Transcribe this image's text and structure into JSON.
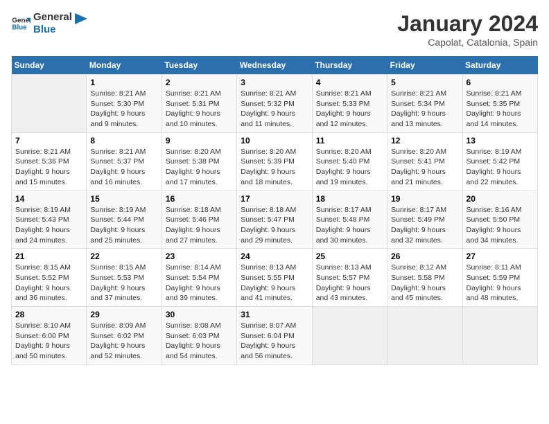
{
  "header": {
    "logo_line1": "General",
    "logo_line2": "Blue",
    "title": "January 2024",
    "subtitle": "Capolat, Catalonia, Spain"
  },
  "weekdays": [
    "Sunday",
    "Monday",
    "Tuesday",
    "Wednesday",
    "Thursday",
    "Friday",
    "Saturday"
  ],
  "weeks": [
    [
      {
        "day": "",
        "info": ""
      },
      {
        "day": "1",
        "info": "Sunrise: 8:21 AM\nSunset: 5:30 PM\nDaylight: 9 hours\nand 9 minutes."
      },
      {
        "day": "2",
        "info": "Sunrise: 8:21 AM\nSunset: 5:31 PM\nDaylight: 9 hours\nand 10 minutes."
      },
      {
        "day": "3",
        "info": "Sunrise: 8:21 AM\nSunset: 5:32 PM\nDaylight: 9 hours\nand 11 minutes."
      },
      {
        "day": "4",
        "info": "Sunrise: 8:21 AM\nSunset: 5:33 PM\nDaylight: 9 hours\nand 12 minutes."
      },
      {
        "day": "5",
        "info": "Sunrise: 8:21 AM\nSunset: 5:34 PM\nDaylight: 9 hours\nand 13 minutes."
      },
      {
        "day": "6",
        "info": "Sunrise: 8:21 AM\nSunset: 5:35 PM\nDaylight: 9 hours\nand 14 minutes."
      }
    ],
    [
      {
        "day": "7",
        "info": "Sunrise: 8:21 AM\nSunset: 5:36 PM\nDaylight: 9 hours\nand 15 minutes."
      },
      {
        "day": "8",
        "info": "Sunrise: 8:21 AM\nSunset: 5:37 PM\nDaylight: 9 hours\nand 16 minutes."
      },
      {
        "day": "9",
        "info": "Sunrise: 8:20 AM\nSunset: 5:38 PM\nDaylight: 9 hours\nand 17 minutes."
      },
      {
        "day": "10",
        "info": "Sunrise: 8:20 AM\nSunset: 5:39 PM\nDaylight: 9 hours\nand 18 minutes."
      },
      {
        "day": "11",
        "info": "Sunrise: 8:20 AM\nSunset: 5:40 PM\nDaylight: 9 hours\nand 19 minutes."
      },
      {
        "day": "12",
        "info": "Sunrise: 8:20 AM\nSunset: 5:41 PM\nDaylight: 9 hours\nand 21 minutes."
      },
      {
        "day": "13",
        "info": "Sunrise: 8:19 AM\nSunset: 5:42 PM\nDaylight: 9 hours\nand 22 minutes."
      }
    ],
    [
      {
        "day": "14",
        "info": "Sunrise: 8:19 AM\nSunset: 5:43 PM\nDaylight: 9 hours\nand 24 minutes."
      },
      {
        "day": "15",
        "info": "Sunrise: 8:19 AM\nSunset: 5:44 PM\nDaylight: 9 hours\nand 25 minutes."
      },
      {
        "day": "16",
        "info": "Sunrise: 8:18 AM\nSunset: 5:46 PM\nDaylight: 9 hours\nand 27 minutes."
      },
      {
        "day": "17",
        "info": "Sunrise: 8:18 AM\nSunset: 5:47 PM\nDaylight: 9 hours\nand 29 minutes."
      },
      {
        "day": "18",
        "info": "Sunrise: 8:17 AM\nSunset: 5:48 PM\nDaylight: 9 hours\nand 30 minutes."
      },
      {
        "day": "19",
        "info": "Sunrise: 8:17 AM\nSunset: 5:49 PM\nDaylight: 9 hours\nand 32 minutes."
      },
      {
        "day": "20",
        "info": "Sunrise: 8:16 AM\nSunset: 5:50 PM\nDaylight: 9 hours\nand 34 minutes."
      }
    ],
    [
      {
        "day": "21",
        "info": "Sunrise: 8:15 AM\nSunset: 5:52 PM\nDaylight: 9 hours\nand 36 minutes."
      },
      {
        "day": "22",
        "info": "Sunrise: 8:15 AM\nSunset: 5:53 PM\nDaylight: 9 hours\nand 37 minutes."
      },
      {
        "day": "23",
        "info": "Sunrise: 8:14 AM\nSunset: 5:54 PM\nDaylight: 9 hours\nand 39 minutes."
      },
      {
        "day": "24",
        "info": "Sunrise: 8:13 AM\nSunset: 5:55 PM\nDaylight: 9 hours\nand 41 minutes."
      },
      {
        "day": "25",
        "info": "Sunrise: 8:13 AM\nSunset: 5:57 PM\nDaylight: 9 hours\nand 43 minutes."
      },
      {
        "day": "26",
        "info": "Sunrise: 8:12 AM\nSunset: 5:58 PM\nDaylight: 9 hours\nand 45 minutes."
      },
      {
        "day": "27",
        "info": "Sunrise: 8:11 AM\nSunset: 5:59 PM\nDaylight: 9 hours\nand 48 minutes."
      }
    ],
    [
      {
        "day": "28",
        "info": "Sunrise: 8:10 AM\nSunset: 6:00 PM\nDaylight: 9 hours\nand 50 minutes."
      },
      {
        "day": "29",
        "info": "Sunrise: 8:09 AM\nSunset: 6:02 PM\nDaylight: 9 hours\nand 52 minutes."
      },
      {
        "day": "30",
        "info": "Sunrise: 8:08 AM\nSunset: 6:03 PM\nDaylight: 9 hours\nand 54 minutes."
      },
      {
        "day": "31",
        "info": "Sunrise: 8:07 AM\nSunset: 6:04 PM\nDaylight: 9 hours\nand 56 minutes."
      },
      {
        "day": "",
        "info": ""
      },
      {
        "day": "",
        "info": ""
      },
      {
        "day": "",
        "info": ""
      }
    ]
  ]
}
